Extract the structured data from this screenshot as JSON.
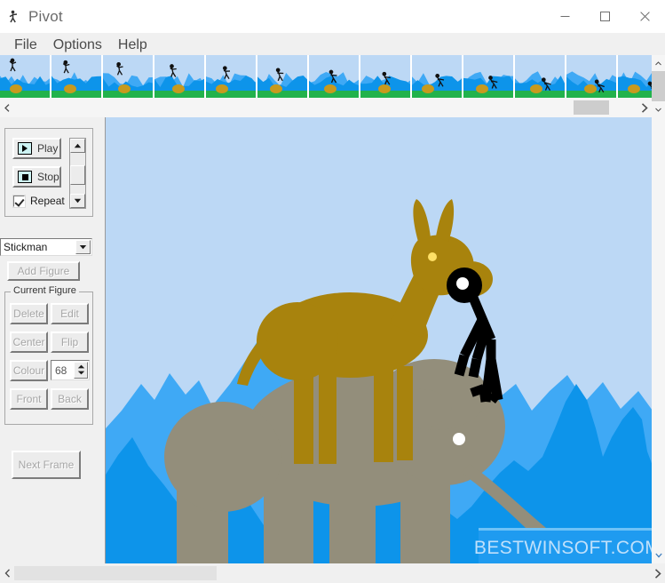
{
  "window": {
    "title": "Pivot",
    "app_icon": "stickman-icon",
    "controls": {
      "minimize": "minimize-icon",
      "maximize": "maximize-icon",
      "close": "close-icon"
    }
  },
  "menu": {
    "items": [
      {
        "label": "File"
      },
      {
        "label": "Options"
      },
      {
        "label": "Help"
      }
    ]
  },
  "filmstrip": {
    "frame_count": 13,
    "frames": [
      {
        "index": 1,
        "pose": "standing-upright"
      },
      {
        "index": 2,
        "pose": "standing-upright"
      },
      {
        "index": 3,
        "pose": "arms-raised"
      },
      {
        "index": 4,
        "pose": "leaning"
      },
      {
        "index": 5,
        "pose": "leaning"
      },
      {
        "index": 6,
        "pose": "bent-over"
      },
      {
        "index": 7,
        "pose": "crouching"
      },
      {
        "index": 8,
        "pose": "crouching"
      },
      {
        "index": 9,
        "pose": "crouching"
      },
      {
        "index": 10,
        "pose": "crouching"
      },
      {
        "index": 11,
        "pose": "crouching"
      },
      {
        "index": 12,
        "pose": "crouching"
      },
      {
        "index": 13,
        "pose": "crouching"
      }
    ],
    "scroll_left_arrow": "chevron-left-icon",
    "scroll_right_arrow": "chevron-right-icon",
    "scroll_up_arrow": "chevron-up-icon",
    "scroll_down_arrow": "chevron-down-icon"
  },
  "playback": {
    "play_label": "Play",
    "stop_label": "Stop",
    "repeat_label": "Repeat",
    "repeat_checked": true,
    "play_icon": "play-triangle-icon",
    "stop_icon": "stop-square-icon",
    "speed_up_arrow": "triangle-up-icon",
    "speed_down_arrow": "triangle-down-icon"
  },
  "figure_picker": {
    "selected": "Stickman",
    "dropdown_icon": "chevron-down-icon",
    "add_figure_label": "Add Figure",
    "add_figure_enabled": false
  },
  "current_figure": {
    "legend": "Current Figure",
    "buttons": [
      {
        "label": "Delete",
        "enabled": false
      },
      {
        "label": "Edit",
        "enabled": false
      },
      {
        "label": "Center",
        "enabled": false
      },
      {
        "label": "Flip",
        "enabled": false
      },
      {
        "label": "Colour",
        "enabled": false
      },
      {
        "label": "Front",
        "enabled": false
      },
      {
        "label": "Back",
        "enabled": false
      }
    ],
    "colour_value": "68",
    "spin_up_icon": "triangle-up-icon",
    "spin_down_icon": "triangle-down-icon"
  },
  "next_frame": {
    "label": "Next Frame",
    "enabled": false
  },
  "canvas": {
    "sky_color": "#bcd8f5",
    "mountain_back_color": "#3fa9f5",
    "mountain_front_color": "#0d94ea",
    "figures": [
      {
        "name": "elephant",
        "color": "#938e7b",
        "eye_color": "#ffffff"
      },
      {
        "name": "donkey",
        "color": "#a8830d",
        "eye_color": "#ffe066"
      },
      {
        "name": "stickman",
        "color": "#000000",
        "eye_color": "#ffffff"
      }
    ]
  },
  "watermark": {
    "text": "BESTWINSOFT.COM",
    "bar_color": "#1f9bf0",
    "text_color": "#bfe0fb"
  },
  "bottom_scrollbar": {
    "left_arrow": "chevron-left-icon",
    "right_arrow": "chevron-right-icon"
  }
}
